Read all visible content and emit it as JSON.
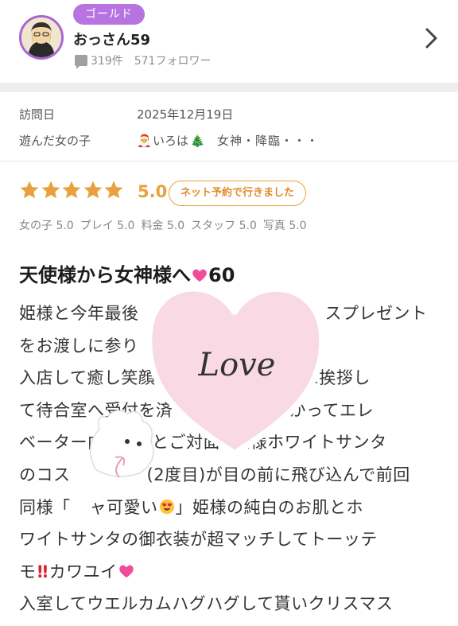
{
  "header": {
    "badge": "ゴールド",
    "user_name": "おっさん59",
    "review_count": "319件",
    "followers": "571フォロワー"
  },
  "visit": {
    "date_label": "訪問日",
    "date_value": "2025年12月19日",
    "girl_label": "遊んだ女の子",
    "girl_name": "いろは",
    "girl_title": "女神・降臨・・・"
  },
  "rating": {
    "score": "5.0",
    "reserve_tag": "ネット予約で行きました",
    "star_count": 5,
    "star_color": "#e8a23d",
    "sub": [
      "女の子 5.0",
      "プレイ 5.0",
      "料金 5.0",
      "スタッフ 5.0",
      "写真 5.0"
    ]
  },
  "review": {
    "title_prefix": "天使様から女神様へ",
    "title_suffix": "60",
    "lines": [
      "姫様と今年最後",
      "をお渡しに参り",
      "入店して癒し笑顔",
      "て待合室へ受付を済",
      "ベーター内",
      "のコス",
      "同様「",
      "ワイトサンタの御衣装が超マッチしてトーッテ",
      "モ",
      "入室してウエルカムハグハグして貰いクリスマス"
    ],
    "line_tails": [
      "スプレゼント",
      "",
      "ッフ様に挨拶し",
      "呼びが掛かってエレ",
      "様とご対面",
      "(2度目)が目の前に飛び込んで前回",
      "」姫様の純白のお肌とホ",
      "",
      "カワユイ",
      ""
    ],
    "line7_mid": "ャ可愛い",
    "line5_tail2": "姫様ホワイトサンタ",
    "sticker_text": "Love"
  },
  "colors": {
    "accent_purple": "#b773e0",
    "star": "#e8a23d",
    "heart_sticker": "#f9d9e3"
  }
}
